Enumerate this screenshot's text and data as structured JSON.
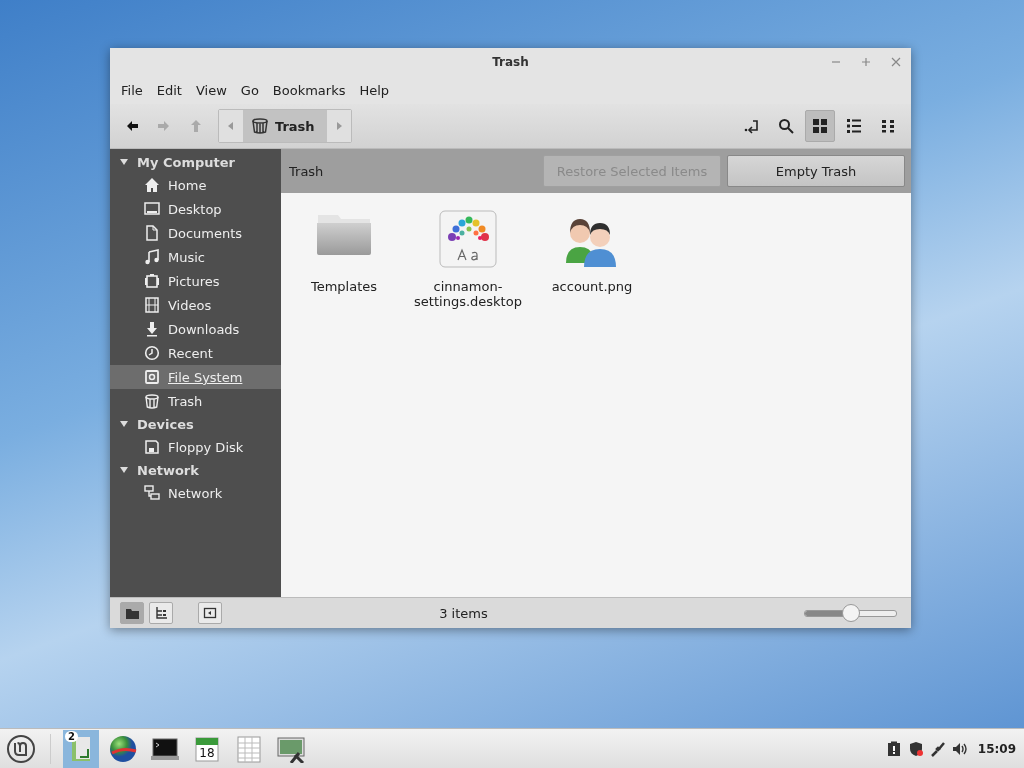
{
  "window": {
    "title": "Trash"
  },
  "menu": [
    "File",
    "Edit",
    "View",
    "Go",
    "Bookmarks",
    "Help"
  ],
  "toolbar": {
    "nav": [
      {
        "disabled": false
      },
      {
        "disabled": true
      },
      {
        "disabled": true
      }
    ],
    "path": {
      "label": "Trash"
    },
    "views": [
      {
        "selected": true
      },
      {
        "selected": false
      },
      {
        "selected": false
      }
    ]
  },
  "sidebar": [
    {
      "heading": "My Computer",
      "expanded": true,
      "items": [
        {
          "label": "Home",
          "selected": false
        },
        {
          "label": "Desktop",
          "selected": false
        },
        {
          "label": "Documents",
          "selected": false
        },
        {
          "label": "Music",
          "selected": false
        },
        {
          "label": "Pictures",
          "selected": false
        },
        {
          "label": "Videos",
          "selected": false
        },
        {
          "label": "Downloads",
          "selected": false
        },
        {
          "label": "Recent",
          "selected": false
        },
        {
          "label": "File System",
          "selected": true
        },
        {
          "label": "Trash",
          "selected": false
        }
      ]
    },
    {
      "heading": "Devices",
      "expanded": true,
      "items": [
        {
          "label": "Floppy Disk",
          "selected": false
        }
      ]
    },
    {
      "heading": "Network",
      "expanded": true,
      "items": [
        {
          "label": "Network",
          "selected": false
        }
      ]
    }
  ],
  "location_bar": {
    "title": "Trash",
    "buttons": [
      {
        "label": "Restore Selected Items",
        "disabled": true
      },
      {
        "label": "Empty Trash",
        "disabled": false
      }
    ]
  },
  "files": [
    {
      "name": "Templates",
      "kind": "folder"
    },
    {
      "name": "cinnamon-settings.desktop",
      "kind": "settings"
    },
    {
      "name": "account.png",
      "kind": "people"
    }
  ],
  "status_bar": {
    "panes": [
      {
        "selected": true
      },
      {
        "selected": false
      }
    ],
    "text": "3 items",
    "zoom": {
      "level": 0.5
    }
  },
  "taskbar": {
    "launchers": [
      {
        "active": true,
        "badge": "2"
      },
      {
        "active": false
      },
      {
        "active": false
      },
      {
        "active": false,
        "day": "18"
      },
      {
        "active": false
      },
      {
        "active": false
      }
    ],
    "clock": "15:09"
  }
}
